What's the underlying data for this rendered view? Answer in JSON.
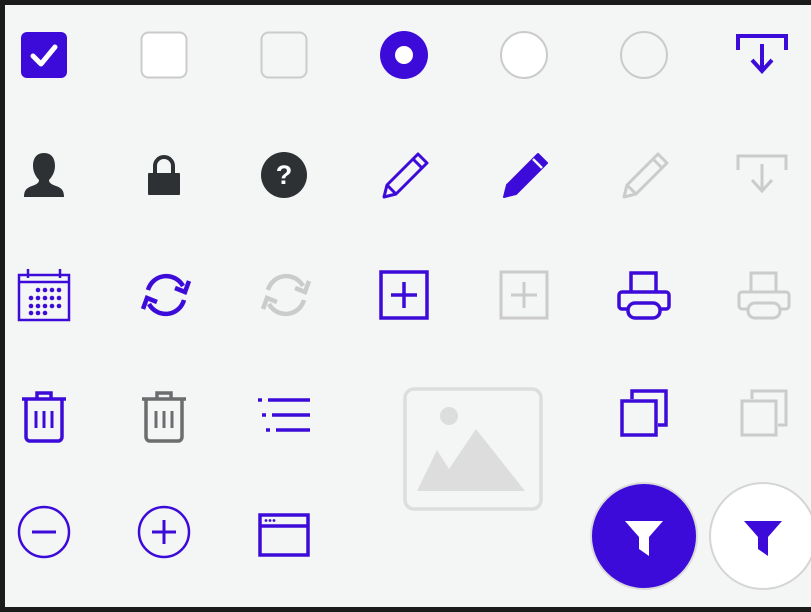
{
  "colors": {
    "accent": "#3d0bd9",
    "dark": "#2e3133",
    "disabled": "#cbcbcb",
    "placeholder": "#dddddd",
    "background": "#f4f5f5",
    "frame": "#1b1b1b",
    "white": "#ffffff"
  },
  "icons": {
    "checkbox_checked": "checkbox-checked-icon",
    "checkbox_unchecked": "checkbox-unchecked-icon",
    "checkbox_disabled": "checkbox-disabled-icon",
    "radio_selected": "radio-selected-icon",
    "radio_unselected": "radio-unselected-icon",
    "radio_disabled": "radio-disabled-icon",
    "download": "download-icon",
    "user": "user-icon",
    "lock": "lock-icon",
    "help": "help-icon",
    "edit": "pencil-icon",
    "calendar": "calendar-icon",
    "refresh": "refresh-icon",
    "add_box": "add-box-icon",
    "print": "print-icon",
    "trash": "trash-icon",
    "list": "list-icon",
    "image_placeholder": "image-placeholder-icon",
    "copy": "copy-icon",
    "remove": "minus-circle-icon",
    "add": "plus-circle-icon",
    "browser_window": "browser-window-icon",
    "filter": "filter-icon"
  },
  "text": {
    "help_glyph": "?"
  }
}
